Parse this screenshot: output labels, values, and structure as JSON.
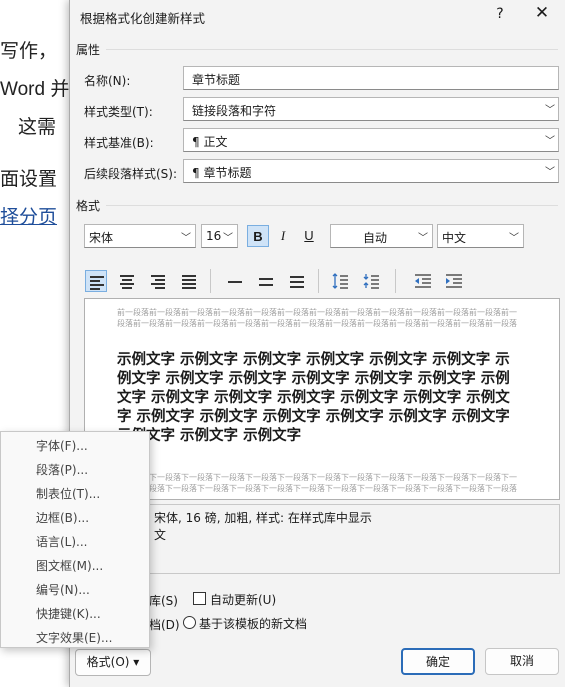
{
  "background_doc": {
    "line1": "写作，",
    "line2": "Word 并",
    "line3": "这需",
    "line4": "面设置",
    "line5_link": "择分页"
  },
  "dialog": {
    "title": "根据格式化创建新样式",
    "help_label": "?",
    "close_label": "✕"
  },
  "properties": {
    "section_label": "属性",
    "name_label": "名称(N):",
    "name_value": "章节标题",
    "type_label": "样式类型(T):",
    "type_value": "链接段落和字符",
    "base_label": "样式基准(B):",
    "base_value": "¶ 正文",
    "next_label": "后续段落样式(S):",
    "next_value": "¶ 章节标题"
  },
  "format": {
    "section_label": "格式",
    "font": "宋体",
    "size": "16",
    "bold": "B",
    "italic": "I",
    "underline": "U",
    "color": "自动",
    "lang": "中文"
  },
  "preview": {
    "prev_para": "前一段落前一段落前一段落前一段落前一段落前一段落前一段落前一段落前一段落前一段落前一段落前一段落前一段落前一段落前一段落前一段落前一段落前一段落前一段落前一段落前一段落前一段落前一段落前一段落前一段落",
    "sample": "示例文字 示例文字 示例文字 示例文字 示例文字 示例文字 示例文字 示例文字 示例文字 示例文字 示例文字 示例文字 示例文字 示例文字 示例文字 示例文字 示例文字 示例文字 示例文字 示例文字 示例文字 示例文字 示例文字 示例文字 示例文字 示例文字 示例文字 示例文字",
    "next_para": "下一段落下一段落下一段落下一段落下一段落下一段落下一段落下一段落下一段落下一段落下一段落下一段落下一段落下一段落下一段落下一段落下一段落下一段落下一段落下一段落下一段落下一段落下一段落下一段落下一段落"
  },
  "description": {
    "line1": "宋体, 16 磅, 加粗, 样式: 在样式库中显示",
    "line2": "文"
  },
  "options": {
    "add_to_gallery": "库(S)",
    "auto_update": "自动更新(U)",
    "this_doc": "档(D)",
    "new_docs": "基于该模板的新文档"
  },
  "buttons": {
    "format": "格式(O) ▾",
    "ok": "确定",
    "cancel": "取消"
  },
  "format_menu": {
    "items": [
      "字体(F)...",
      "段落(P)...",
      "制表位(T)...",
      "边框(B)...",
      "语言(L)...",
      "图文框(M)...",
      "编号(N)...",
      "快捷键(K)...",
      "文字效果(E)..."
    ]
  }
}
